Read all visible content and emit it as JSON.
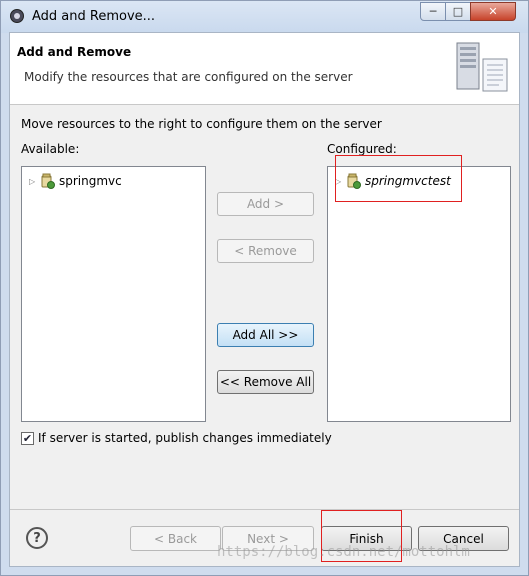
{
  "window": {
    "title": "Add and Remove...",
    "minimize_glyph": "─",
    "maximize_glyph": "□",
    "close_glyph": "✕"
  },
  "header": {
    "title": "Add and Remove",
    "description": "Modify the resources that are configured on the server",
    "icon": "server-icon"
  },
  "body": {
    "instruction": "Move resources to the right to configure them on the server",
    "available_label": "Available:",
    "configured_label": "Configured:",
    "available_items": [
      {
        "label": "springmvc",
        "icon": "web-module-icon",
        "expanded": false
      }
    ],
    "configured_items": [
      {
        "label": "springmvctest",
        "icon": "web-module-icon",
        "expanded": false
      }
    ]
  },
  "buttons": {
    "add": "Add >",
    "remove": "< Remove",
    "add_all": "Add All >>",
    "remove_all": "<< Remove All"
  },
  "publish_checkbox": {
    "label": "If server is started, publish changes immediately",
    "checked": true,
    "check_glyph": "✔"
  },
  "footer": {
    "help_glyph": "?",
    "back": "< Back",
    "next": "Next >",
    "finish": "Finish",
    "cancel": "Cancel"
  },
  "watermark": "https://blog.csdn.net/mottohlm",
  "colors": {
    "highlight_border": "#e02020",
    "focus_border": "#3c7fb1"
  }
}
